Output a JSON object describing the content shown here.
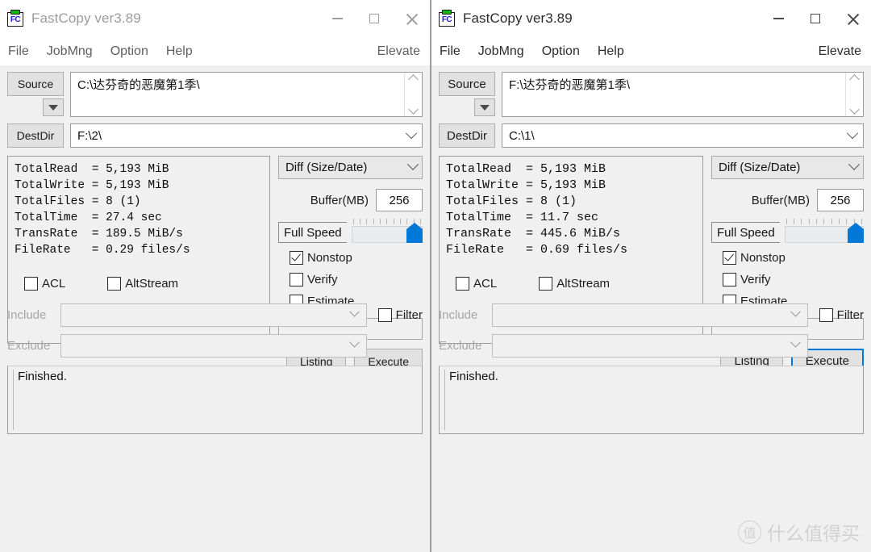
{
  "window_title": "FastCopy ver3.89",
  "menu": {
    "items": [
      "File",
      "JobMng",
      "Option",
      "Help"
    ],
    "elevate": "Elevate"
  },
  "labels": {
    "source": "Source",
    "destdir": "DestDir",
    "buffer": "Buffer(MB)",
    "full_speed": "Full Speed",
    "nonstop": "Nonstop",
    "verify": "Verify",
    "estimate": "Estimate",
    "acl": "ACL",
    "altstream": "AltStream",
    "include": "Include",
    "exclude": "Exclude",
    "filter": "Filter",
    "listing": "Listing",
    "execute": "Execute"
  },
  "colors": {
    "accent": "#0078d7",
    "window_bg": "#f0f0f0",
    "titlebar_bg": "#ffffff"
  },
  "left": {
    "source_path": "C:\\达芬奇的恶魔第1季\\",
    "dest_path": "F:\\2\\",
    "mode": "Diff (Size/Date)",
    "buffer_value": "256",
    "stats": "TotalRead  = 5,193 MiB\nTotalWrite = 5,193 MiB\nTotalFiles = 8 (1)\nTotalTime  = 27.4 sec\nTransRate  = 189.5 MiB/s\nFileRate   = 0.29 files/s",
    "stat_rows": [
      {
        "name": "TotalRead",
        "value": "5,193 MiB"
      },
      {
        "name": "TotalWrite",
        "value": "5,193 MiB"
      },
      {
        "name": "TotalFiles",
        "value": "8 (1)"
      },
      {
        "name": "TotalTime",
        "value": "27.4 sec"
      },
      {
        "name": "TransRate",
        "value": "189.5 MiB/s"
      },
      {
        "name": "FileRate",
        "value": "0.29 files/s"
      }
    ],
    "include_value": "",
    "exclude_value": "",
    "log": "Finished.",
    "extra_field_value": ""
  },
  "right": {
    "source_path": "F:\\达芬奇的恶魔第1季\\",
    "dest_path": "C:\\1\\",
    "mode": "Diff (Size/Date)",
    "buffer_value": "256",
    "stats": "TotalRead  = 5,193 MiB\nTotalWrite = 5,193 MiB\nTotalFiles = 8 (1)\nTotalTime  = 11.7 sec\nTransRate  = 445.6 MiB/s\nFileRate   = 0.69 files/s",
    "stat_rows": [
      {
        "name": "TotalRead",
        "value": "5,193 MiB"
      },
      {
        "name": "TotalWrite",
        "value": "5,193 MiB"
      },
      {
        "name": "TotalFiles",
        "value": "8 (1)"
      },
      {
        "name": "TotalTime",
        "value": "11.7 sec"
      },
      {
        "name": "TransRate",
        "value": "445.6 MiB/s"
      },
      {
        "name": "FileRate",
        "value": "0.69 files/s"
      }
    ],
    "include_value": "",
    "exclude_value": "",
    "log": "Finished.",
    "extra_field_value": ""
  },
  "watermark": {
    "badge": "值",
    "text": "什么值得买"
  }
}
